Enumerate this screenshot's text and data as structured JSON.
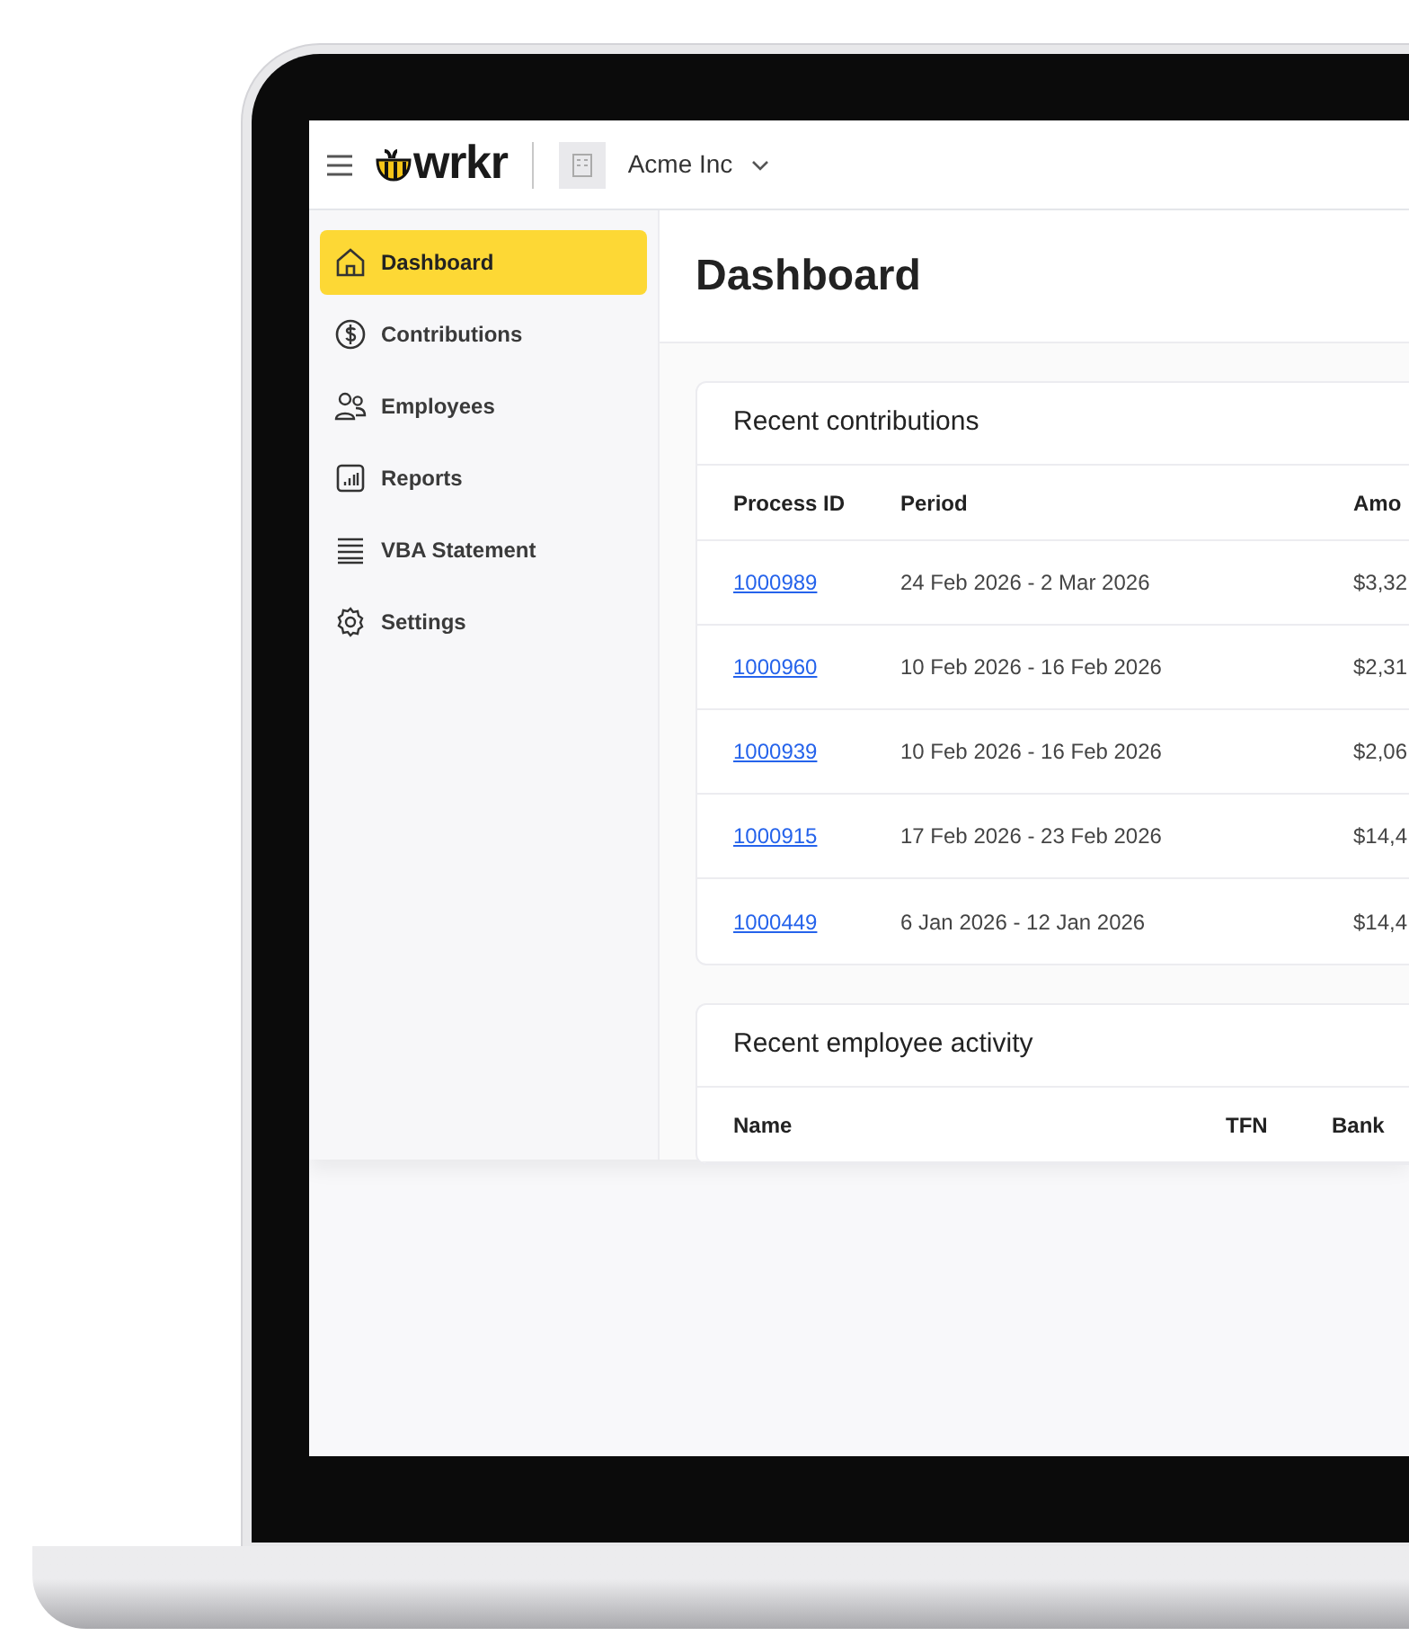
{
  "header": {
    "logo_text": "wrkr",
    "organization": "Acme Inc"
  },
  "sidebar": {
    "items": [
      {
        "label": "Dashboard",
        "selected": true
      },
      {
        "label": "Contributions",
        "selected": false
      },
      {
        "label": "Employees",
        "selected": false
      },
      {
        "label": "Reports",
        "selected": false
      },
      {
        "label": "VBA Statement",
        "selected": false
      },
      {
        "label": "Settings",
        "selected": false
      }
    ]
  },
  "page_title": "Dashboard",
  "recent_contributions": {
    "title": "Recent contributions",
    "columns": [
      "Process ID",
      "Period",
      "Amo"
    ],
    "rows": [
      {
        "process_id": "1000989",
        "period": "24 Feb 2026 - 2 Mar 2026",
        "amount": "$3,32"
      },
      {
        "process_id": "1000960",
        "period": "10 Feb 2026 - 16 Feb 2026",
        "amount": "$2,31"
      },
      {
        "process_id": "1000939",
        "period": "10 Feb 2026 - 16 Feb 2026",
        "amount": "$2,06"
      },
      {
        "process_id": "1000915",
        "period": "17 Feb 2026 - 23 Feb 2026",
        "amount": "$14,4"
      },
      {
        "process_id": "1000449",
        "period": "6 Jan 2026 - 12 Jan 2026",
        "amount": "$14,4"
      }
    ]
  },
  "recent_employee_activity": {
    "title": "Recent employee activity",
    "columns": [
      "Name",
      "TFN",
      "Bank"
    ]
  }
}
